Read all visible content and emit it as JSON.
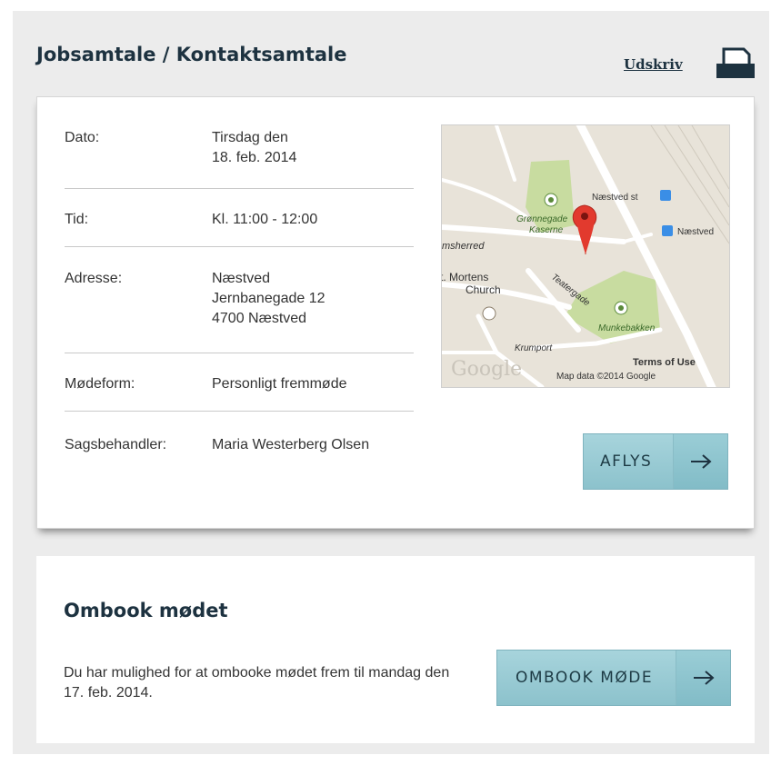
{
  "header": {
    "title": "Jobsamtale / Kontaktsamtale",
    "print_label": "Udskriv"
  },
  "details": {
    "date": {
      "label": "Dato:",
      "lines": [
        "Tirsdag den",
        "18. feb. 2014"
      ]
    },
    "time": {
      "label": "Tid:",
      "lines": [
        "Kl. 11:00 - 12:00"
      ]
    },
    "address": {
      "label": "Adresse:",
      "lines": [
        "Næstved",
        "Jernbanegade 12",
        "4700 Næstved"
      ]
    },
    "meeting_type": {
      "label": "Mødeform:",
      "lines": [
        "Personligt fremmøde"
      ]
    },
    "case_worker": {
      "label": "Sagsbehandler:",
      "lines": [
        "Maria Westerberg Olsen"
      ]
    }
  },
  "map": {
    "labels": {
      "gronnegade": "Grønnegade",
      "kaserne": "Kaserne",
      "station": "Næstved st",
      "naestved": "Næstved",
      "amtsherred": "msherred",
      "mortens1": "t. Mortens",
      "mortens2": "Church",
      "teatergade": "Teatergade",
      "munkebakken": "Munkebakken",
      "krumport": "Krumport",
      "logo": "Google",
      "terms": "Terms of Use",
      "mapdata": "Map data ©2014 Google"
    },
    "colors": {
      "road": "#ffffff",
      "park": "#c8dca0",
      "ground": "#e8e3d9",
      "marker": "#e23a2e"
    }
  },
  "actions": {
    "cancel_label": "AFLYS",
    "rebook_label": "OMBOOK MØDE",
    "arrow_icon": "arrow-right-icon"
  },
  "rebook": {
    "title": "Ombook mødet",
    "text": "Du har mulighed for at ombooke mødet frem til mandag den 17. feb. 2014."
  },
  "colors": {
    "button_bg": "#9ccfd8",
    "heading": "#1d3240",
    "page_bg": "#ececec"
  }
}
